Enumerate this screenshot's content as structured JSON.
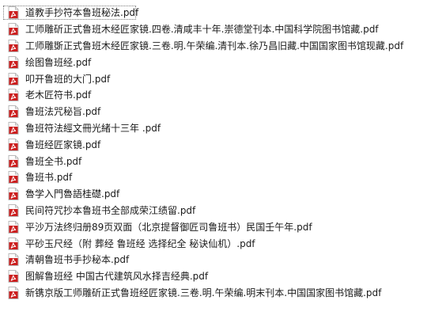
{
  "file_list": {
    "icon": "pdf-file-icon",
    "accent_color": "#cc1f1f",
    "items": [
      {
        "name": "道教手抄符本鲁班秘法.pdf"
      },
      {
        "name": "工师雕斫正式鲁班木经匠家镜.四卷.清咸丰十年.崇德堂刊本.中国科学院图书馆藏.pdf"
      },
      {
        "name": "工师雕斲正式鲁班木经匠家镜.三卷.明.午荣编.清刊本.徐乃昌旧藏.中国国家图书馆现藏.pdf"
      },
      {
        "name": "绘图鲁班经.pdf"
      },
      {
        "name": "叩开鲁班的大门.pdf"
      },
      {
        "name": "老木匠符书.pdf"
      },
      {
        "name": "鲁班法咒秘旨.pdf"
      },
      {
        "name": "鲁班符法經文冊光緒十三年 .pdf"
      },
      {
        "name": "鲁班经匠家镜.pdf"
      },
      {
        "name": "鲁班全书.pdf"
      },
      {
        "name": "鲁班书.pdf"
      },
      {
        "name": "魯学入門魯語桂礎.pdf"
      },
      {
        "name": "民间符咒抄本鲁班书全部成荣江绩留.pdf"
      },
      {
        "name": "平沙万法终归册89页双面（北京提督御匠司鲁班书）民国壬午年.pdf"
      },
      {
        "name": "平砂玉尺经（附 葬经 鲁班经 选择纪全 秘诀仙机）.pdf"
      },
      {
        "name": "清朝鲁班书手抄秘本.pdf"
      },
      {
        "name": "图解鲁班经   中国古代建筑风水择吉经典.pdf"
      },
      {
        "name": "新镌京版工师雕斫正式鲁班经匠家镜.三卷.明.午荣编.明末刊本.中国国家图书馆藏.pdf"
      }
    ]
  }
}
